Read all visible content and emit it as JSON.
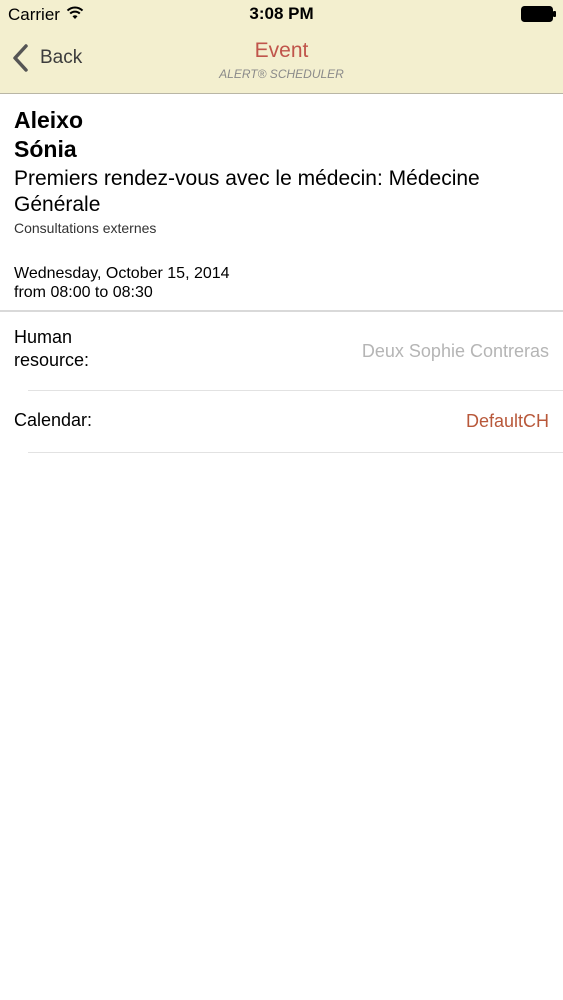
{
  "status_bar": {
    "carrier": "Carrier",
    "time": "3:08 PM",
    "icons": [
      "wifi-icon",
      "battery-icon"
    ]
  },
  "nav": {
    "back_label": "Back",
    "title": "Event",
    "subtitle": "ALERT® SCHEDULER",
    "back_icon": "chevron-left-icon"
  },
  "patient": {
    "last_name": "Aleixo",
    "first_name": "Sónia"
  },
  "appointment": {
    "title": "Premiers rendez-vous avec le médecin: Médecine Générale",
    "department": "Consultations externes",
    "date": "Wednesday, October 15, 2014",
    "time_range": "from 08:00 to 08:30"
  },
  "details": {
    "human_resource_label": "Human resource:",
    "human_resource_value": "Deux Sophie Contreras",
    "calendar_label": "Calendar:",
    "calendar_value": "DefaultCH"
  },
  "colors": {
    "header_bg": "#f3efcf",
    "accent": "#c0554b",
    "muted_value": "#b5b5b5",
    "calendar_value": "#b8583a"
  }
}
